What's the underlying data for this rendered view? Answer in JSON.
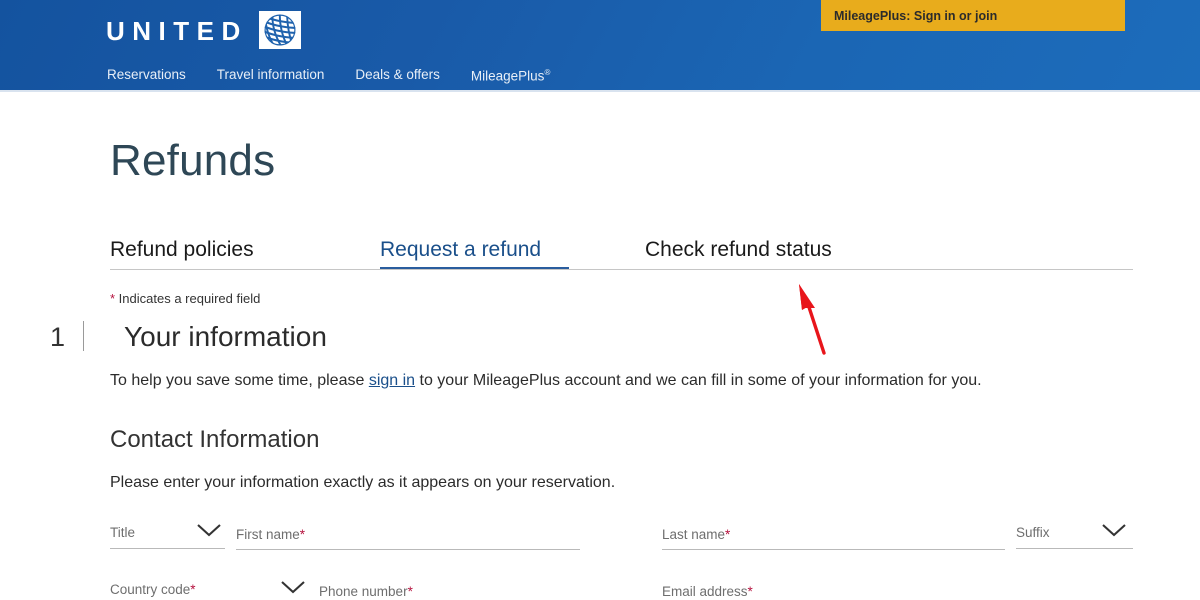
{
  "header": {
    "brand_word": "UNITED",
    "globe_icon": "united-globe-logo",
    "mileageplus_banner": "MileagePlus: Sign in or join",
    "nav": [
      {
        "label": "Reservations"
      },
      {
        "label": "Travel information"
      },
      {
        "label": "Deals & offers"
      },
      {
        "label": "MileagePlus",
        "sup": "®"
      }
    ],
    "colors": {
      "nav_blue": "#195aa8",
      "banner_gold": "#e8ac1c"
    }
  },
  "page": {
    "title": "Refunds"
  },
  "tabs": [
    {
      "label": "Refund policies",
      "active": false
    },
    {
      "label": "Request a refund",
      "active": true
    },
    {
      "label": "Check refund status",
      "active": false
    }
  ],
  "form": {
    "required_note_star": "*",
    "required_note_text": " Indicates a required field",
    "step_number": "1",
    "step_divider": "|",
    "step_title": "Your information",
    "signin_prefix": "To help you save some time, please ",
    "signin_link": "sign in",
    "signin_suffix": " to your MileagePlus account and we can fill in some of your information for you.",
    "section_heading": "Contact Information",
    "section_subtext": "Please enter your information exactly as it appears on your reservation.",
    "fields": [
      {
        "label": "Title",
        "required": false,
        "type": "select",
        "value": "",
        "placeholder": "Title"
      },
      {
        "label": "First name",
        "required": true,
        "type": "text",
        "value": "",
        "placeholder": "First name"
      },
      {
        "label": "Last name",
        "required": true,
        "type": "text",
        "value": "",
        "placeholder": "Last name"
      },
      {
        "label": "Suffix",
        "required": false,
        "type": "select",
        "value": "",
        "placeholder": "Suffix"
      },
      {
        "label": "Country code",
        "required": true,
        "type": "select",
        "value": "",
        "placeholder": "Country code"
      },
      {
        "label": "Phone number",
        "required": true,
        "type": "text",
        "value": "",
        "placeholder": "Phone number"
      },
      {
        "label": "Email address",
        "required": true,
        "type": "text",
        "value": "",
        "placeholder": "Email address"
      }
    ]
  },
  "annotation": {
    "arrow_icon": "red-pointer-arrow",
    "color": "#e8151b"
  }
}
